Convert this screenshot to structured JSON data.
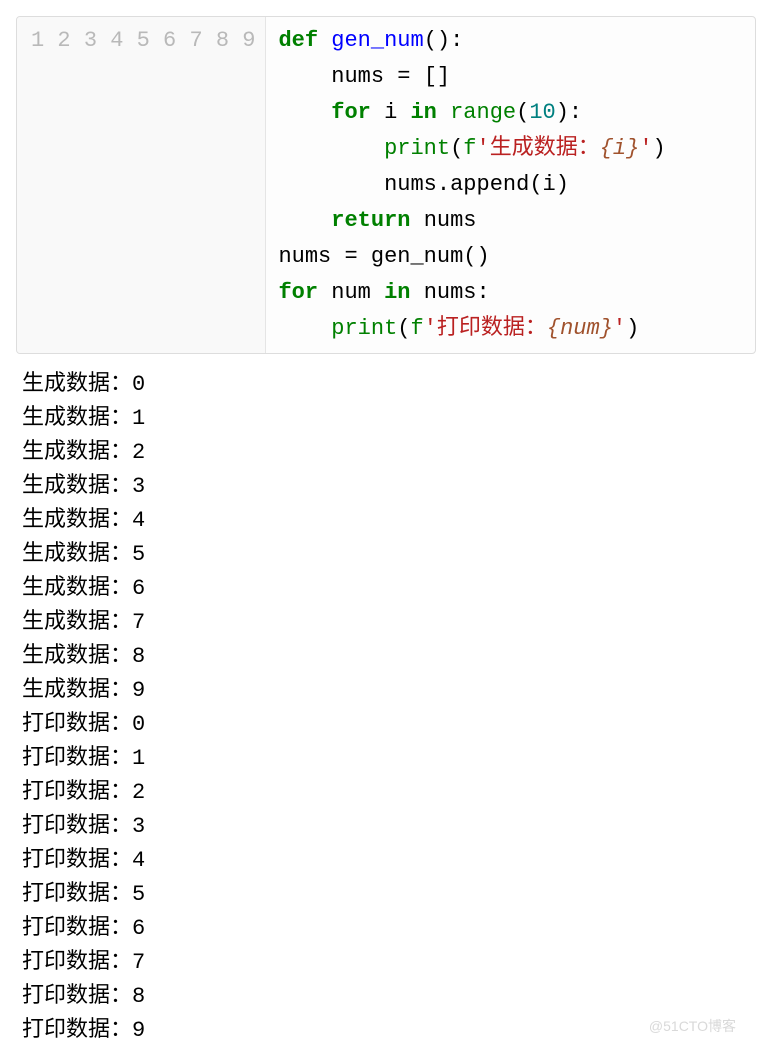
{
  "code": {
    "lineNumbers": [
      "1",
      "2",
      "3",
      "4",
      "5",
      "6",
      "7",
      "8",
      "9"
    ],
    "line1": {
      "kw_def": "def",
      "sp1": " ",
      "fn": "gen_num",
      "pun": "():"
    },
    "line2": {
      "indent": "    ",
      "id": "nums",
      "sp": " ",
      "op": "=",
      "sp2": " ",
      "br": "[]"
    },
    "line3": {
      "indent": "    ",
      "kw_for": "for",
      "sp1": " ",
      "id": "i",
      "sp2": " ",
      "kw_in": "in",
      "sp3": " ",
      "bi": "range",
      "op": "(",
      "num": "10",
      "cp": "):"
    },
    "line4": {
      "indent": "        ",
      "bi": "print",
      "op": "(",
      "f": "f",
      "q1": "'",
      "txt": "生成数据：",
      "io": "{",
      "iv": "i",
      "ic": "}",
      "q2": "'",
      "cp": ")"
    },
    "line5": {
      "indent": "        ",
      "id": "nums",
      "dot": ".",
      "meth": "append",
      "op": "(",
      "arg": "i",
      "cp": ")"
    },
    "line6": {
      "indent": "    ",
      "kw": "return",
      "sp": " ",
      "id": "nums"
    },
    "line7": {
      "id1": "nums",
      "sp1": " ",
      "op": "=",
      "sp2": " ",
      "id2": "gen_num",
      "call": "()"
    },
    "line8": {
      "kw_for": "for",
      "sp1": " ",
      "id": "num",
      "sp2": " ",
      "kw_in": "in",
      "sp3": " ",
      "id2": "nums",
      "colon": ":"
    },
    "line9": {
      "indent": "    ",
      "bi": "print",
      "op": "(",
      "f": "f",
      "q1": "'",
      "txt": "打印数据：",
      "io": "{",
      "iv": "num",
      "ic": "}",
      "q2": "'",
      "cp": ")"
    }
  },
  "output_lines": [
    "生成数据：0",
    "生成数据：1",
    "生成数据：2",
    "生成数据：3",
    "生成数据：4",
    "生成数据：5",
    "生成数据：6",
    "生成数据：7",
    "生成数据：8",
    "生成数据：9",
    "打印数据：0",
    "打印数据：1",
    "打印数据：2",
    "打印数据：3",
    "打印数据：4",
    "打印数据：5",
    "打印数据：6",
    "打印数据：7",
    "打印数据：8",
    "打印数据：9"
  ],
  "watermark": "@51CTO博客"
}
